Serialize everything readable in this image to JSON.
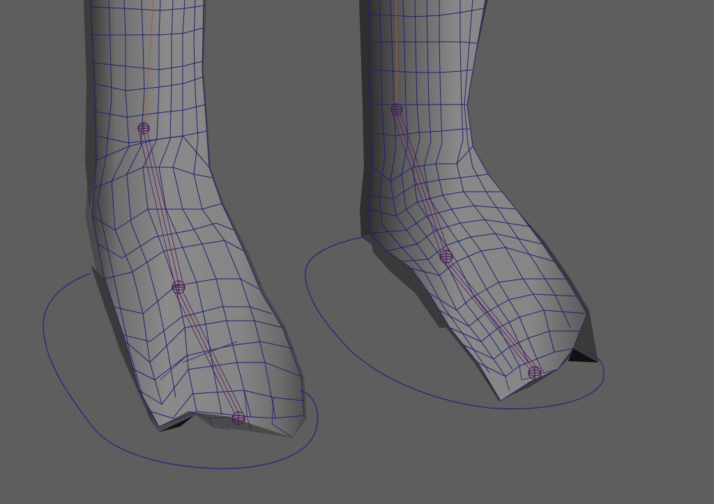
{
  "viewport": {
    "background": "#5e5e5e",
    "mesh_light": "#8e8e8e",
    "mesh_mid": "#777777",
    "mesh_dark": "#4a4a4a",
    "mesh_shadow": "#1a1a1a",
    "wire_color": "#1f1f6e",
    "control_curve_color": "#26267a",
    "joint_color": "#4a1850",
    "bone_axis_color": "#a0603a"
  }
}
